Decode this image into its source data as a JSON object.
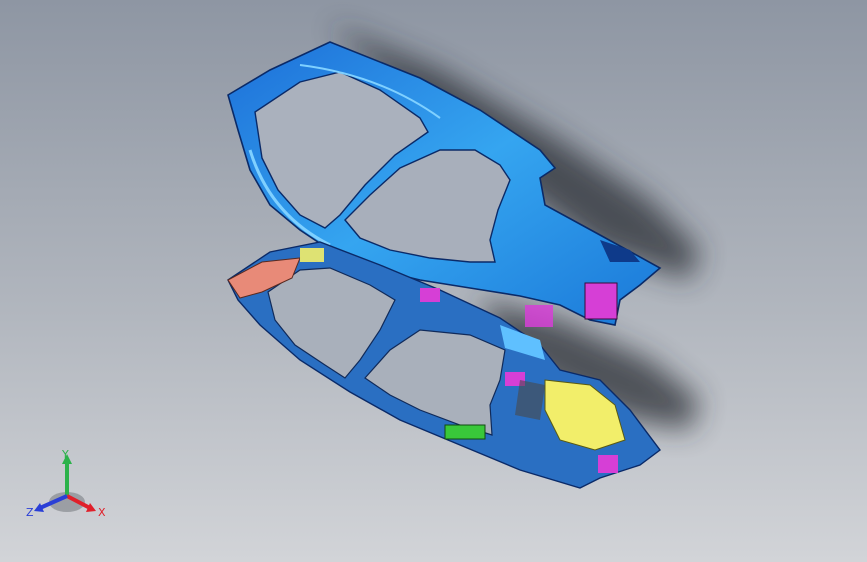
{
  "viewport": {
    "background_top": "#8e96a3",
    "background_bottom": "#d2d4d8"
  },
  "model": {
    "upper_part_color": "#1e7fe0",
    "upper_part_highlight": "#5fc0ff",
    "lower_part_color": "#2a6fc2",
    "accent_magenta": "#d63fd6",
    "accent_yellow": "#f2ee6a",
    "accent_green": "#39c83a",
    "accent_salmon": "#e88a78"
  },
  "triad": {
    "x_label": "X",
    "y_label": "Y",
    "z_label": "Z",
    "x_color": "#e0202a",
    "y_color": "#2bb24a",
    "z_color": "#2a3fd6",
    "icon": "axis-triad-icon"
  }
}
